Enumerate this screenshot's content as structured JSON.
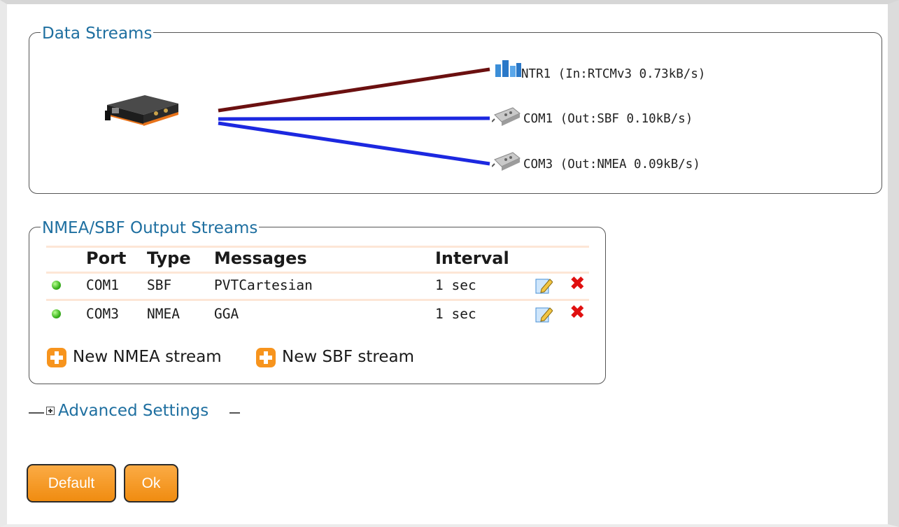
{
  "data_streams": {
    "legend": "Data Streams",
    "streams": [
      {
        "label": "NTR1 (In:RTCMv3 0.73kB/s)",
        "icon": "ntrip-icon",
        "line_color": "#6b1010"
      },
      {
        "label": "COM1 (Out:SBF 0.10kB/s)",
        "icon": "serial-port-icon",
        "line_color": "#1c28e0"
      },
      {
        "label": "COM3 (Out:NMEA 0.09kB/s)",
        "icon": "serial-port-icon",
        "line_color": "#1c28e0"
      }
    ],
    "receiver_icon": "gnss-receiver-icon"
  },
  "output_streams": {
    "legend": "NMEA/SBF Output Streams",
    "columns": {
      "port": "Port",
      "type": "Type",
      "messages": "Messages",
      "interval": "Interval"
    },
    "rows": [
      {
        "port": "COM1",
        "type": "SBF",
        "messages": "PVTCartesian",
        "interval": "1 sec",
        "status": "active"
      },
      {
        "port": "COM3",
        "type": "NMEA",
        "messages": "GGA",
        "interval": "1 sec",
        "status": "active"
      }
    ],
    "new_nmea_label": "New NMEA stream",
    "new_sbf_label": "New SBF stream"
  },
  "advanced": {
    "label": "Advanced Settings",
    "expanded": false
  },
  "buttons": {
    "default_label": "Default",
    "ok_label": "Ok"
  },
  "colors": {
    "accent": "#1e6fa0",
    "button": "#f7941d",
    "delete": "#e01010",
    "status_ok": "#39b21c"
  }
}
